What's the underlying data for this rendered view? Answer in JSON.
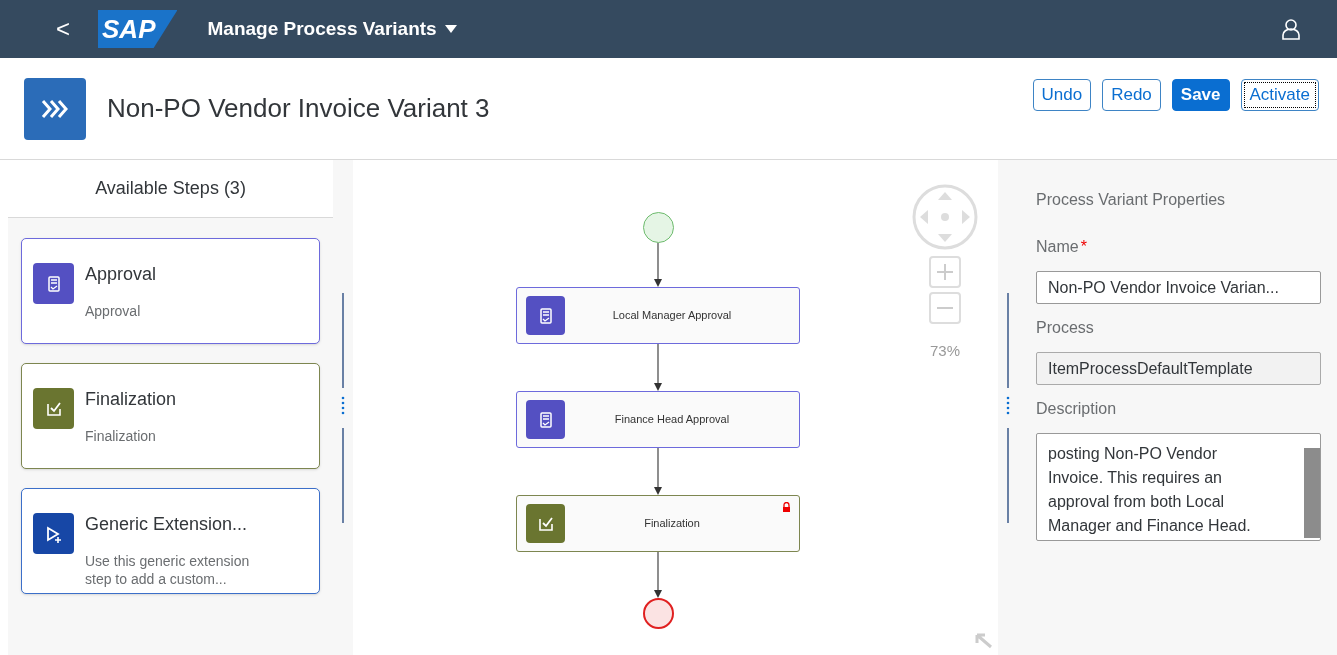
{
  "shell": {
    "back": "<",
    "logo": "SAP",
    "title": "Manage Process Variants"
  },
  "header": {
    "title": "Non-PO Vendor Invoice Variant 3",
    "buttons": [
      {
        "label": "Undo",
        "kind": "default",
        "focused": false
      },
      {
        "label": "Redo",
        "kind": "default",
        "focused": false
      },
      {
        "label": "Save",
        "kind": "emphasized",
        "focused": false
      },
      {
        "label": "Activate",
        "kind": "default",
        "focused": true
      }
    ]
  },
  "available_steps": {
    "title": "Available Steps (3)",
    "items": [
      {
        "kind": "approval",
        "title": "Approval",
        "subtitle": "Approval"
      },
      {
        "kind": "finalization",
        "title": "Finalization",
        "subtitle": "Finalization"
      },
      {
        "kind": "extension",
        "title": "Generic Extension...",
        "subtitle": "Use this generic extension step to add a custom..."
      }
    ]
  },
  "canvas": {
    "zoom": "73%",
    "nodes": [
      {
        "kind": "approval",
        "label": "Local Manager Approval",
        "warning": false
      },
      {
        "kind": "approval",
        "label": "Finance Head Approval",
        "warning": false
      },
      {
        "kind": "finalization",
        "label": "Finalization",
        "warning": true
      }
    ]
  },
  "properties": {
    "title": "Process Variant Properties",
    "fields": [
      {
        "kind": "input",
        "label": "Name",
        "required_mark": "*",
        "value": "Non-PO Vendor Invoice Varian...",
        "disabled": false
      },
      {
        "kind": "input",
        "label": "Process",
        "value": "ItemProcessDefaultTemplate",
        "disabled": true
      },
      {
        "kind": "textarea",
        "label": "Description",
        "value": "posting Non-PO Vendor Invoice. This requires an approval from both Local Manager and Finance Head."
      }
    ]
  }
}
